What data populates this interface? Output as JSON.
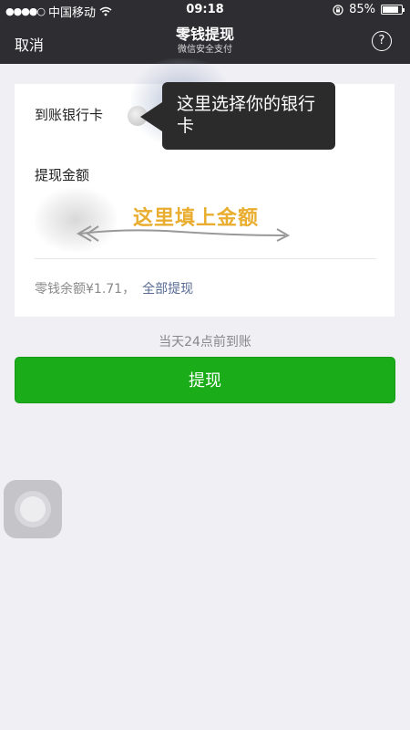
{
  "status_bar": {
    "signal_dots": "●●●●○",
    "carrier": "中国移动",
    "wifi_icon": "wifi-icon",
    "time": "09:18",
    "orientation_lock_icon": "lock-rotation-icon",
    "battery_percent": "85%",
    "battery_level": 0.85
  },
  "nav": {
    "cancel_label": "取消",
    "title": "零钱提现",
    "subtitle": "微信安全支付",
    "help_label": "?"
  },
  "form": {
    "bank_label": "到账银行卡",
    "amount_label": "提现金额",
    "balance_text": "零钱余额¥1.71，",
    "withdraw_all_label": "全部提现"
  },
  "annotations": {
    "bank_tip": "这里选择你的银行卡",
    "amount_tip": "这里填上金额"
  },
  "arrival_note": "当天24点前到账",
  "submit_label": "提现",
  "colors": {
    "nav_bg": "#2e2e32",
    "primary_green": "#1aad19",
    "link_blue": "#576b95",
    "page_bg": "#efeff4",
    "hint_yellow": "#e9ad2f"
  }
}
